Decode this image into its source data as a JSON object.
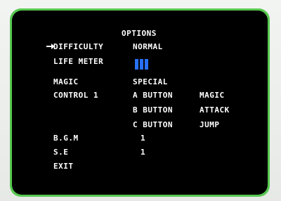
{
  "title": "OPTIONS",
  "items": {
    "difficulty": {
      "label": "DIFFICULTY",
      "value": "NORMAL"
    },
    "life_meter": {
      "label": "LIFE METER",
      "bars": 3,
      "color": "#2870f8"
    },
    "magic": {
      "label": "MAGIC",
      "value": "SPECIAL"
    },
    "control": {
      "label": "CONTROL 1",
      "mappings": [
        {
          "button": "A BUTTON",
          "action": "MAGIC"
        },
        {
          "button": "B BUTTON",
          "action": "ATTACK"
        },
        {
          "button": "C BUTTON",
          "action": "JUMP"
        }
      ]
    },
    "bgm": {
      "label": "B.G.M",
      "value": "1"
    },
    "se": {
      "label": "S.E",
      "value": "1"
    },
    "exit": {
      "label": "EXIT"
    }
  },
  "cursor": {
    "icon": "arrow-right-icon",
    "selected": "difficulty"
  },
  "colors": {
    "frame": "#58c850",
    "screen": "#000000",
    "text": "#ffffff"
  }
}
